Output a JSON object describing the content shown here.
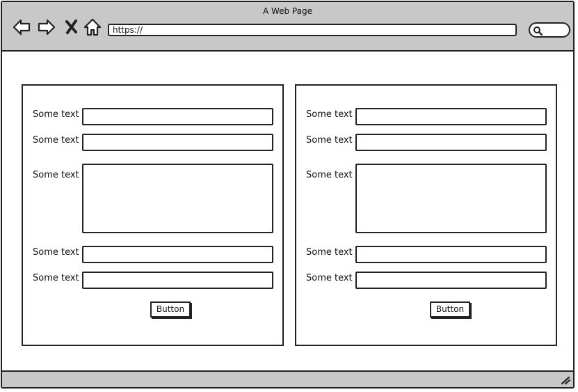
{
  "window": {
    "title": "A Web Page"
  },
  "toolbar": {
    "url": "https://",
    "icons": [
      "back-arrow-icon",
      "forward-arrow-icon",
      "close-x-icon",
      "home-icon",
      "search-icon"
    ]
  },
  "forms": [
    {
      "labels": [
        "Some text",
        "Some text",
        "Some text",
        "Some text",
        "Some text"
      ],
      "button": "Button"
    },
    {
      "labels": [
        "Some text",
        "Some text",
        "Some text",
        "Some text",
        "Some text"
      ],
      "button": "Button"
    }
  ]
}
